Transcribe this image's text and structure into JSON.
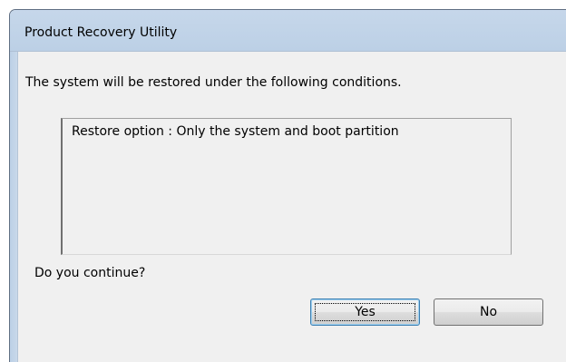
{
  "window": {
    "title": "Product Recovery Utility"
  },
  "dialog": {
    "message": "The system will be restored under the following conditions.",
    "conditions_text": "Restore option : Only the system and boot partition",
    "question": "Do you continue?"
  },
  "buttons": {
    "yes_label": "Yes",
    "no_label": "No"
  },
  "colors": {
    "titlebar": "#bcd0e6",
    "client_background": "#f0f0f0",
    "default_button_border": "#3c7fb1"
  }
}
